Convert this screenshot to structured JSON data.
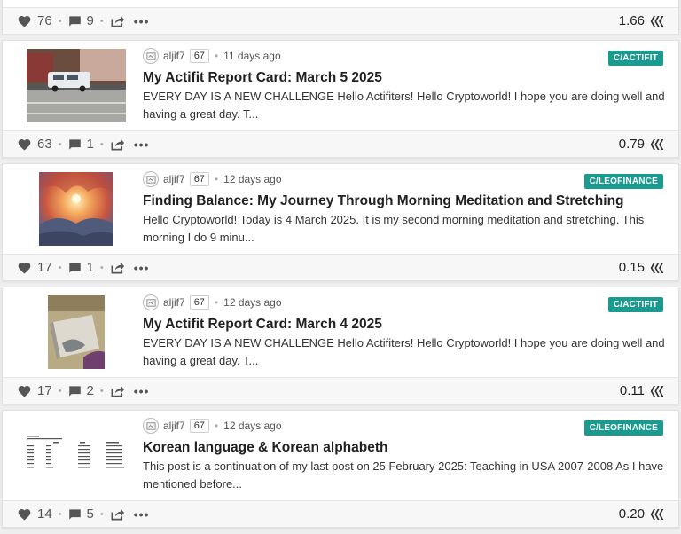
{
  "top_footer": {
    "likes": "76",
    "comments": "9",
    "payout": "1.66"
  },
  "posts": [
    {
      "author": "aljif7",
      "reputation": "67",
      "age": "11 days ago",
      "community": "C/ACTIFIT",
      "title": "My Actifit Report Card: March 5 2025",
      "summary": "EVERY DAY IS A NEW CHALLENGE Hello Actifiters! Hello Cryptoworld! I hope you are doing well and having a great day. T...",
      "likes": "63",
      "comments": "1",
      "payout": "0.79",
      "thumb_kind": "street"
    },
    {
      "author": "aljif7",
      "reputation": "67",
      "age": "12 days ago",
      "community": "C/LEOFINANCE",
      "title": "Finding Balance: My Journey Through Morning Meditation and Stretching",
      "summary": "Hello Cryptoworld! Today is 4 March 2025. It is my second morning meditation and stretching. This morning I do 9 minu...",
      "likes": "17",
      "comments": "1",
      "payout": "0.15",
      "thumb_kind": "sunset"
    },
    {
      "author": "aljif7",
      "reputation": "67",
      "age": "12 days ago",
      "community": "C/ACTIFIT",
      "title": "My Actifit Report Card: March 4 2025",
      "summary": "EVERY DAY IS A NEW CHALLENGE Hello Actifiters! Hello Cryptoworld! I hope you are doing well and having a great day. T...",
      "likes": "17",
      "comments": "2",
      "payout": "0.11",
      "thumb_kind": "sofa"
    },
    {
      "author": "aljif7",
      "reputation": "67",
      "age": "12 days ago",
      "community": "C/LEOFINANCE",
      "title": "Korean language & Korean alphabeth",
      "summary": "This post is a continuation of my last post on 25 February 2025: Teaching in USA 2007-2008 As I have mentioned before...",
      "likes": "14",
      "comments": "5",
      "payout": "0.20",
      "thumb_kind": "table"
    }
  ],
  "colors": {
    "tag": "#1b9a90",
    "footer_bg": "#f7f7f7",
    "page_bg": "#eeeeee"
  },
  "icons": [
    "heart-icon",
    "comment-icon",
    "share-icon",
    "more-icon",
    "hive-icon",
    "avatar-icon"
  ]
}
